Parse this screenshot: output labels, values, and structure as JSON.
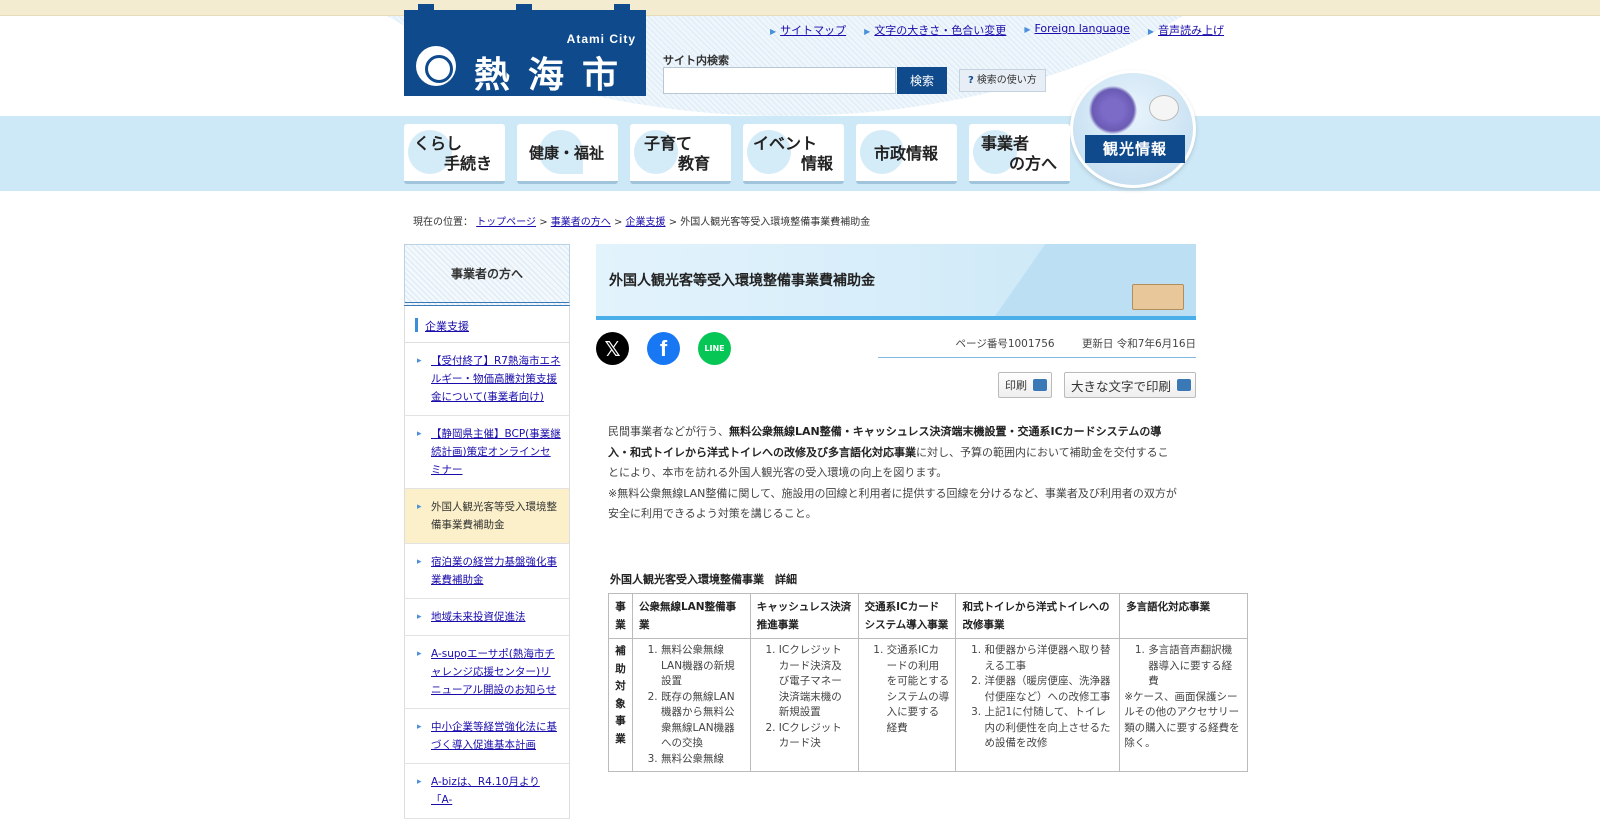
{
  "header": {
    "logo_en": "Atami City",
    "logo_jp": "熱海市",
    "top_links": [
      "サイトマップ",
      "文字の大きさ・色合い変更",
      "Foreign language",
      "音声読み上げ"
    ],
    "search_label": "サイト内検索",
    "search_value": "",
    "search_button": "検索",
    "search_help": "検索の使い方",
    "kanko": "観光情報"
  },
  "nav": [
    {
      "line1": "くらし",
      "line2": "手続き"
    },
    {
      "line1": "健康・福祉",
      "line2": ""
    },
    {
      "line1": "子育て",
      "line2": "教育"
    },
    {
      "line1": "イベント",
      "line2": "情報"
    },
    {
      "line1": "市政情報",
      "line2": ""
    },
    {
      "line1": "事業者",
      "line2": "の方へ"
    }
  ],
  "breadcrumb": {
    "label": "現在の位置：",
    "links": [
      "トップページ",
      "事業者の方へ",
      "企業支援"
    ],
    "current": "外国人観光客等受入環境整備事業費補助金",
    "sep": ">"
  },
  "sidebar": {
    "head": "事業者の方へ",
    "category": "企業支援",
    "items": [
      "【受付終了】R7熱海市エネルギー・物価高騰対策支援金について(事業者向け)",
      "【静岡県主催】BCP(事業継続計画)策定オンラインセミナー",
      "外国人観光客等受入環境整備事業費補助金",
      "宿泊業の経営力基盤強化事業費補助金",
      "地域未来投資促進法",
      "A-supoエーサポ(熱海市チャレンジ応援センター)リニューアル開設のお知らせ",
      "中小企業等経営強化法に基づく導入促進基本計画",
      "A-bizは、R4.10月より「A-"
    ]
  },
  "main": {
    "title": "外国人観光客等受入環境整備事業費補助金",
    "page_number": "ページ番号1001756",
    "updated": "更新日 令和7年6月16日",
    "print": "印刷",
    "print_large": "大きな文字で印刷",
    "p1_a": "民間事業者などが行う、",
    "p1_b": "無料公衆無線LAN整備・キャッシュレス決済端末機設置・交通系ICカードシステムの導入・和式トイレから洋式トイレへの改修及び多言語化対応事業",
    "p1_c": "に対し、予算の範囲内において補助金を交付することにより、本市を訪れる外国人観光客の受入環境の向上を図ります。",
    "p2": "※無料公衆無線LAN整備に関して、施設用の回線と利用者に提供する回線を分けるなど、事業者及び利用者の双方が安全に利用できるよう対策を講じること。",
    "table_caption": "外国人観光客受入環境整備事業　詳細"
  },
  "table": {
    "headers": [
      "事業",
      "公衆無線LAN整備事業",
      "キャッシュレス決済推進事業",
      "交通系ICカードシステム導入事業",
      "和式トイレから洋式トイレへの改修事業",
      "多言語化対応事業"
    ],
    "row_label": "補助対象事業",
    "cells": [
      {
        "items": [
          "無料公衆無線LAN機器の新規設置",
          "既存の無線LAN機器から無料公衆無線LAN機器への交換",
          "無料公衆無線"
        ],
        "note": ""
      },
      {
        "items": [
          "ICクレジットカード決済及び電子マネー決済端末機の新規設置",
          "ICクレジットカード決"
        ],
        "note": ""
      },
      {
        "items": [
          "交通系ICカードの利用を可能とするシステムの導入に要する経費"
        ],
        "note": ""
      },
      {
        "items": [
          "和便器から洋便器へ取り替える工事",
          "洋便器（暖房便座、洗浄器付便座など）への改修工事",
          "上記1に付随して、トイレ内の利便性を向上させるため設備を改修"
        ],
        "note": ""
      },
      {
        "items": [
          "多言語音声翻訳機器導入に要する経費"
        ],
        "note": "※ケース、画面保護シールその他のアクセサリー類の購入に要する経費を除く。"
      }
    ]
  }
}
